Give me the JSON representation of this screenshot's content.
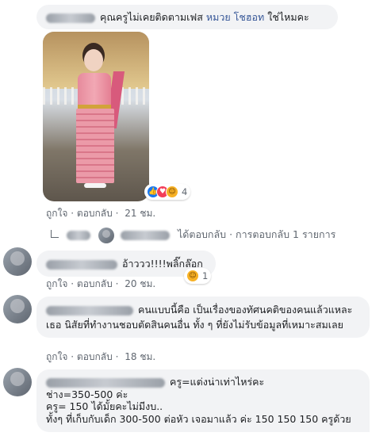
{
  "comments": [
    {
      "text_prefix": "คุณครูไม่เคยติดตามเฟส",
      "mention": "หมวย โชฮอท",
      "text_suffix": "ใช่ไหมคะ",
      "reactions_count": "4",
      "like_label": "ถูกใจ",
      "reply_label": "ตอบกลับ",
      "time": "21 ชม."
    },
    {
      "text": "อ้าววว!!!!พลิ๊กล๊อก",
      "reactions_count": "1",
      "like_label": "ถูกใจ",
      "reply_label": "ตอบกลับ",
      "time": "20 ชม."
    },
    {
      "text": "คนแบบนี้คือ เป็นเรื่องของทัศนคติของคนแล้วแหละเธอ นิสัยที่ทำงานชอบตัดสินคนอื่น ทั้ง ๆ ที่ยังไม่รับข้อมูลที่เหมาะสมเลย",
      "like_label": "ถูกใจ",
      "reply_label": "ตอบกลับ",
      "time": "18 ชม."
    },
    {
      "line1": "ครู=แต่งน่าเท่าไหร่คะ",
      "line2": "ช่าง=350-500 ค่ะ",
      "line3": "ครู= 150 ได้มั้ยคะไม่มีงบ..",
      "line4": "ทั้งๆ ที่เก็บกับเด็ก 300-500 ต่อหัว เจอมาแล้ว ค่ะ 150 150 150 ครูด้วย"
    }
  ],
  "replies_row": {
    "replied_label": "ได้ตอบกลับ",
    "separator": "·",
    "count_label": "การตอบกลับ 1 รายการ"
  },
  "separator": "·"
}
